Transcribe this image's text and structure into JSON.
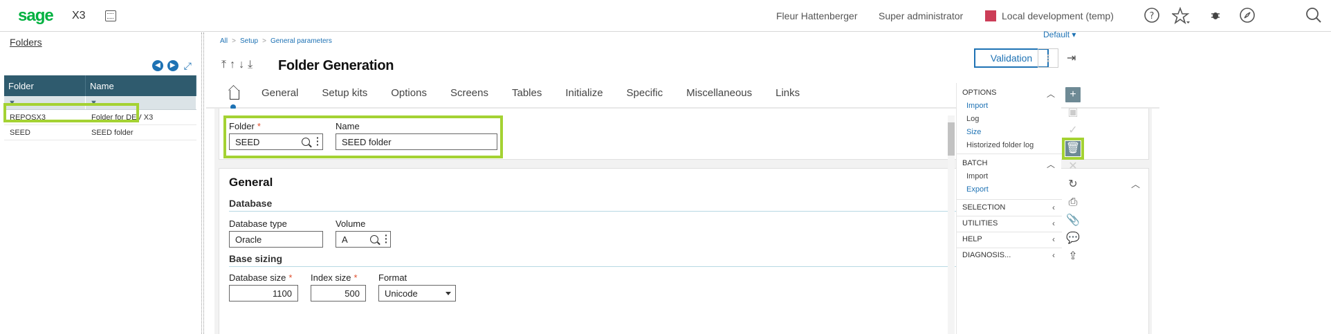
{
  "topbar": {
    "logo": "sage",
    "product": "X3",
    "user": "Fleur Hattenberger",
    "role": "Super administrator",
    "environment": "Local development (temp)",
    "environment_color": "#cc3d57",
    "icons": [
      "help-icon",
      "star-icon",
      "bug-icon",
      "compass-icon",
      "search-icon"
    ]
  },
  "left_panel": {
    "title": "Folders",
    "columns": [
      "Folder",
      "Name"
    ],
    "rows": [
      {
        "folder": "REPOSX3",
        "name": "Folder for DEV X3"
      },
      {
        "folder": "SEED",
        "name": "SEED folder"
      }
    ]
  },
  "breadcrumb": [
    "All",
    "Setup",
    "General parameters"
  ],
  "view_selector": "Default",
  "page": {
    "title": "Folder Generation",
    "tabs": [
      "General",
      "Setup kits",
      "Options",
      "Screens",
      "Tables",
      "Initialize",
      "Specific",
      "Miscellaneous",
      "Links"
    ],
    "validate_label": "Validation"
  },
  "header_fields": {
    "folder_label": "Folder",
    "folder_value": "SEED",
    "name_label": "Name",
    "name_value": "SEED folder"
  },
  "general": {
    "title": "General",
    "database_section": "Database",
    "db_type_label": "Database type",
    "db_type_value": "Oracle",
    "volume_label": "Volume",
    "volume_value": "A",
    "sizing_section": "Base sizing",
    "db_size_label": "Database size",
    "db_size_value": "1100",
    "index_size_label": "Index size",
    "index_size_value": "500",
    "format_label": "Format",
    "format_value": "Unicode"
  },
  "right_panel": {
    "options_title": "OPTIONS",
    "options_items": [
      "Import",
      "Log",
      "Size",
      "Historized folder log"
    ],
    "batch_title": "BATCH",
    "batch_items": [
      "Import",
      "Export"
    ],
    "selection_title": "SELECTION",
    "utilities_title": "UTILITIES",
    "help_title": "HELP",
    "diagnosis_title": "DIAGNOSIS..."
  },
  "highlight_color": "#a4d233"
}
